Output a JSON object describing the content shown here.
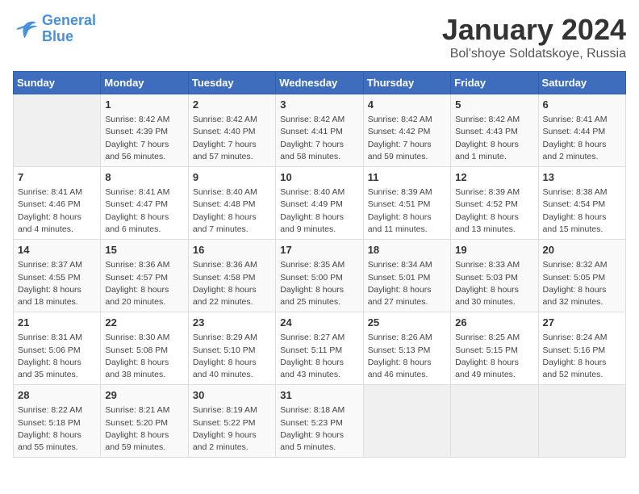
{
  "logo": {
    "line1": "General",
    "line2": "Blue"
  },
  "title": "January 2024",
  "location": "Bol'shoye Soldatskoye, Russia",
  "days_of_week": [
    "Sunday",
    "Monday",
    "Tuesday",
    "Wednesday",
    "Thursday",
    "Friday",
    "Saturday"
  ],
  "weeks": [
    [
      {
        "day": "",
        "info": ""
      },
      {
        "day": "1",
        "info": "Sunrise: 8:42 AM\nSunset: 4:39 PM\nDaylight: 7 hours\nand 56 minutes."
      },
      {
        "day": "2",
        "info": "Sunrise: 8:42 AM\nSunset: 4:40 PM\nDaylight: 7 hours\nand 57 minutes."
      },
      {
        "day": "3",
        "info": "Sunrise: 8:42 AM\nSunset: 4:41 PM\nDaylight: 7 hours\nand 58 minutes."
      },
      {
        "day": "4",
        "info": "Sunrise: 8:42 AM\nSunset: 4:42 PM\nDaylight: 7 hours\nand 59 minutes."
      },
      {
        "day": "5",
        "info": "Sunrise: 8:42 AM\nSunset: 4:43 PM\nDaylight: 8 hours\nand 1 minute."
      },
      {
        "day": "6",
        "info": "Sunrise: 8:41 AM\nSunset: 4:44 PM\nDaylight: 8 hours\nand 2 minutes."
      }
    ],
    [
      {
        "day": "7",
        "info": "Sunrise: 8:41 AM\nSunset: 4:46 PM\nDaylight: 8 hours\nand 4 minutes."
      },
      {
        "day": "8",
        "info": "Sunrise: 8:41 AM\nSunset: 4:47 PM\nDaylight: 8 hours\nand 6 minutes."
      },
      {
        "day": "9",
        "info": "Sunrise: 8:40 AM\nSunset: 4:48 PM\nDaylight: 8 hours\nand 7 minutes."
      },
      {
        "day": "10",
        "info": "Sunrise: 8:40 AM\nSunset: 4:49 PM\nDaylight: 8 hours\nand 9 minutes."
      },
      {
        "day": "11",
        "info": "Sunrise: 8:39 AM\nSunset: 4:51 PM\nDaylight: 8 hours\nand 11 minutes."
      },
      {
        "day": "12",
        "info": "Sunrise: 8:39 AM\nSunset: 4:52 PM\nDaylight: 8 hours\nand 13 minutes."
      },
      {
        "day": "13",
        "info": "Sunrise: 8:38 AM\nSunset: 4:54 PM\nDaylight: 8 hours\nand 15 minutes."
      }
    ],
    [
      {
        "day": "14",
        "info": "Sunrise: 8:37 AM\nSunset: 4:55 PM\nDaylight: 8 hours\nand 18 minutes."
      },
      {
        "day": "15",
        "info": "Sunrise: 8:36 AM\nSunset: 4:57 PM\nDaylight: 8 hours\nand 20 minutes."
      },
      {
        "day": "16",
        "info": "Sunrise: 8:36 AM\nSunset: 4:58 PM\nDaylight: 8 hours\nand 22 minutes."
      },
      {
        "day": "17",
        "info": "Sunrise: 8:35 AM\nSunset: 5:00 PM\nDaylight: 8 hours\nand 25 minutes."
      },
      {
        "day": "18",
        "info": "Sunrise: 8:34 AM\nSunset: 5:01 PM\nDaylight: 8 hours\nand 27 minutes."
      },
      {
        "day": "19",
        "info": "Sunrise: 8:33 AM\nSunset: 5:03 PM\nDaylight: 8 hours\nand 30 minutes."
      },
      {
        "day": "20",
        "info": "Sunrise: 8:32 AM\nSunset: 5:05 PM\nDaylight: 8 hours\nand 32 minutes."
      }
    ],
    [
      {
        "day": "21",
        "info": "Sunrise: 8:31 AM\nSunset: 5:06 PM\nDaylight: 8 hours\nand 35 minutes."
      },
      {
        "day": "22",
        "info": "Sunrise: 8:30 AM\nSunset: 5:08 PM\nDaylight: 8 hours\nand 38 minutes."
      },
      {
        "day": "23",
        "info": "Sunrise: 8:29 AM\nSunset: 5:10 PM\nDaylight: 8 hours\nand 40 minutes."
      },
      {
        "day": "24",
        "info": "Sunrise: 8:27 AM\nSunset: 5:11 PM\nDaylight: 8 hours\nand 43 minutes."
      },
      {
        "day": "25",
        "info": "Sunrise: 8:26 AM\nSunset: 5:13 PM\nDaylight: 8 hours\nand 46 minutes."
      },
      {
        "day": "26",
        "info": "Sunrise: 8:25 AM\nSunset: 5:15 PM\nDaylight: 8 hours\nand 49 minutes."
      },
      {
        "day": "27",
        "info": "Sunrise: 8:24 AM\nSunset: 5:16 PM\nDaylight: 8 hours\nand 52 minutes."
      }
    ],
    [
      {
        "day": "28",
        "info": "Sunrise: 8:22 AM\nSunset: 5:18 PM\nDaylight: 8 hours\nand 55 minutes."
      },
      {
        "day": "29",
        "info": "Sunrise: 8:21 AM\nSunset: 5:20 PM\nDaylight: 8 hours\nand 59 minutes."
      },
      {
        "day": "30",
        "info": "Sunrise: 8:19 AM\nSunset: 5:22 PM\nDaylight: 9 hours\nand 2 minutes."
      },
      {
        "day": "31",
        "info": "Sunrise: 8:18 AM\nSunset: 5:23 PM\nDaylight: 9 hours\nand 5 minutes."
      },
      {
        "day": "",
        "info": ""
      },
      {
        "day": "",
        "info": ""
      },
      {
        "day": "",
        "info": ""
      }
    ]
  ]
}
